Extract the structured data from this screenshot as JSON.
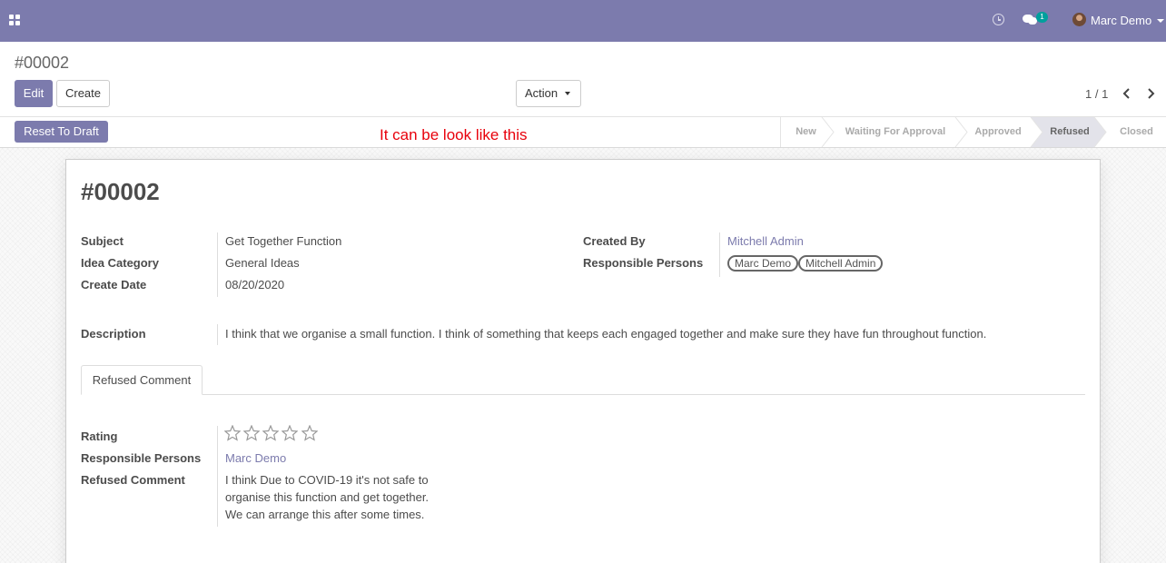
{
  "navbar": {
    "user_name": "Marc Demo",
    "messages_badge": "1",
    "accent_color": "#7c7bad"
  },
  "control_panel": {
    "breadcrumb": "#00002",
    "edit_label": "Edit",
    "create_label": "Create",
    "action_label": "Action",
    "pager_value": "1 / 1"
  },
  "statusbar": {
    "reset_label": "Reset To Draft",
    "annotation": "It can be look like this",
    "annotation_color": "#e8000b",
    "stages": [
      {
        "label": "New",
        "active": false
      },
      {
        "label": "Waiting For Approval",
        "active": false
      },
      {
        "label": "Approved",
        "active": false
      },
      {
        "label": "Refused",
        "active": true
      },
      {
        "label": "Closed",
        "active": false
      }
    ]
  },
  "record": {
    "title": "#00002",
    "left_fields": [
      {
        "label": "Subject",
        "value": "Get Together Function"
      },
      {
        "label": "Idea Category",
        "value": "General Ideas"
      },
      {
        "label": "Create Date",
        "value": "08/20/2020"
      }
    ],
    "created_by": {
      "label": "Created By",
      "value": "Mitchell Admin"
    },
    "responsible": {
      "label": "Responsible Persons",
      "tags": [
        "Marc Demo",
        "Mitchell Admin"
      ]
    },
    "description": {
      "label": "Description",
      "value": "I think that we organise a small function. I think of something that keeps each engaged together and make sure they have fun throughout function."
    }
  },
  "tab": {
    "label": "Refused Comment",
    "rating_label": "Rating",
    "rating_value": 0,
    "rating_max": 5,
    "responsible_label": "Responsible Persons",
    "responsible_value": "Marc Demo",
    "refused_label": "Refused Comment",
    "refused_value": "I think Due to COVID-19 it's not safe to\norganise this function and get together.\nWe can arrange this after some times."
  }
}
